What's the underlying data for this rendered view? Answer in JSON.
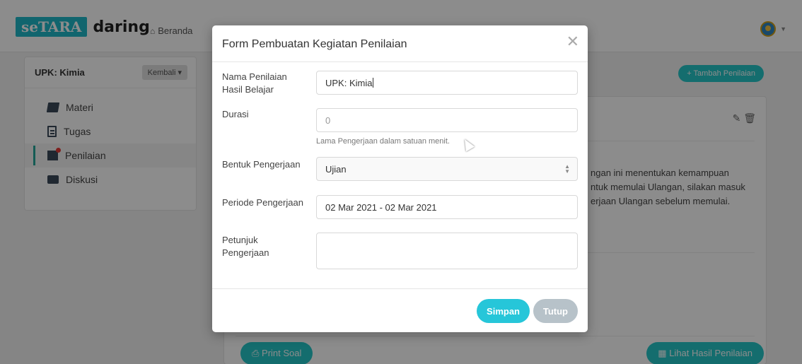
{
  "navbar": {
    "logo_badge": "seTARA",
    "logo_word": "daring",
    "home_label": "Beranda"
  },
  "sidebar": {
    "title": "UPK: Kimia",
    "back_label": "Kembali",
    "items": [
      {
        "label": "Materi",
        "icon": "book-icon"
      },
      {
        "label": "Tugas",
        "icon": "document-icon"
      },
      {
        "label": "Penilaian",
        "icon": "assessment-icon",
        "active": true
      },
      {
        "label": "Diskusi",
        "icon": "chat-icon"
      }
    ]
  },
  "main": {
    "add_label": "+ Tambah Penilaian",
    "text_lines": [
      "ngan ini menentukan kemampuan",
      "ntuk memulai Ulangan, silakan masuk",
      "erjaan Ulangan sebelum memulai."
    ],
    "print_label": "Print Soal",
    "results_label": "Lihat Hasil Penilaian"
  },
  "modal": {
    "title": "Form Pembuatan Kegiatan Penilaian",
    "close_glyph": "✕",
    "fields": {
      "name": {
        "label": "Nama Penilaian Hasil Belajar",
        "value": "UPK: Kimia"
      },
      "duration": {
        "label": "Durasi",
        "placeholder": "0",
        "help": "Lama Pengerjaan dalam satuan menit."
      },
      "form": {
        "label": "Bentuk Pengerjaan",
        "value": "Ujian"
      },
      "period": {
        "label": "Periode Pengerjaan",
        "value": "02 Mar 2021 - 02 Mar 2021"
      },
      "instructions": {
        "label": "Petunjuk Pengerjaan",
        "value": ""
      }
    },
    "save_label": "Simpan",
    "close_label": "Tutup"
  },
  "colors": {
    "accent": "#26c6d9",
    "muted_button": "#b7c2c9",
    "brand": "#1fb8c9"
  }
}
